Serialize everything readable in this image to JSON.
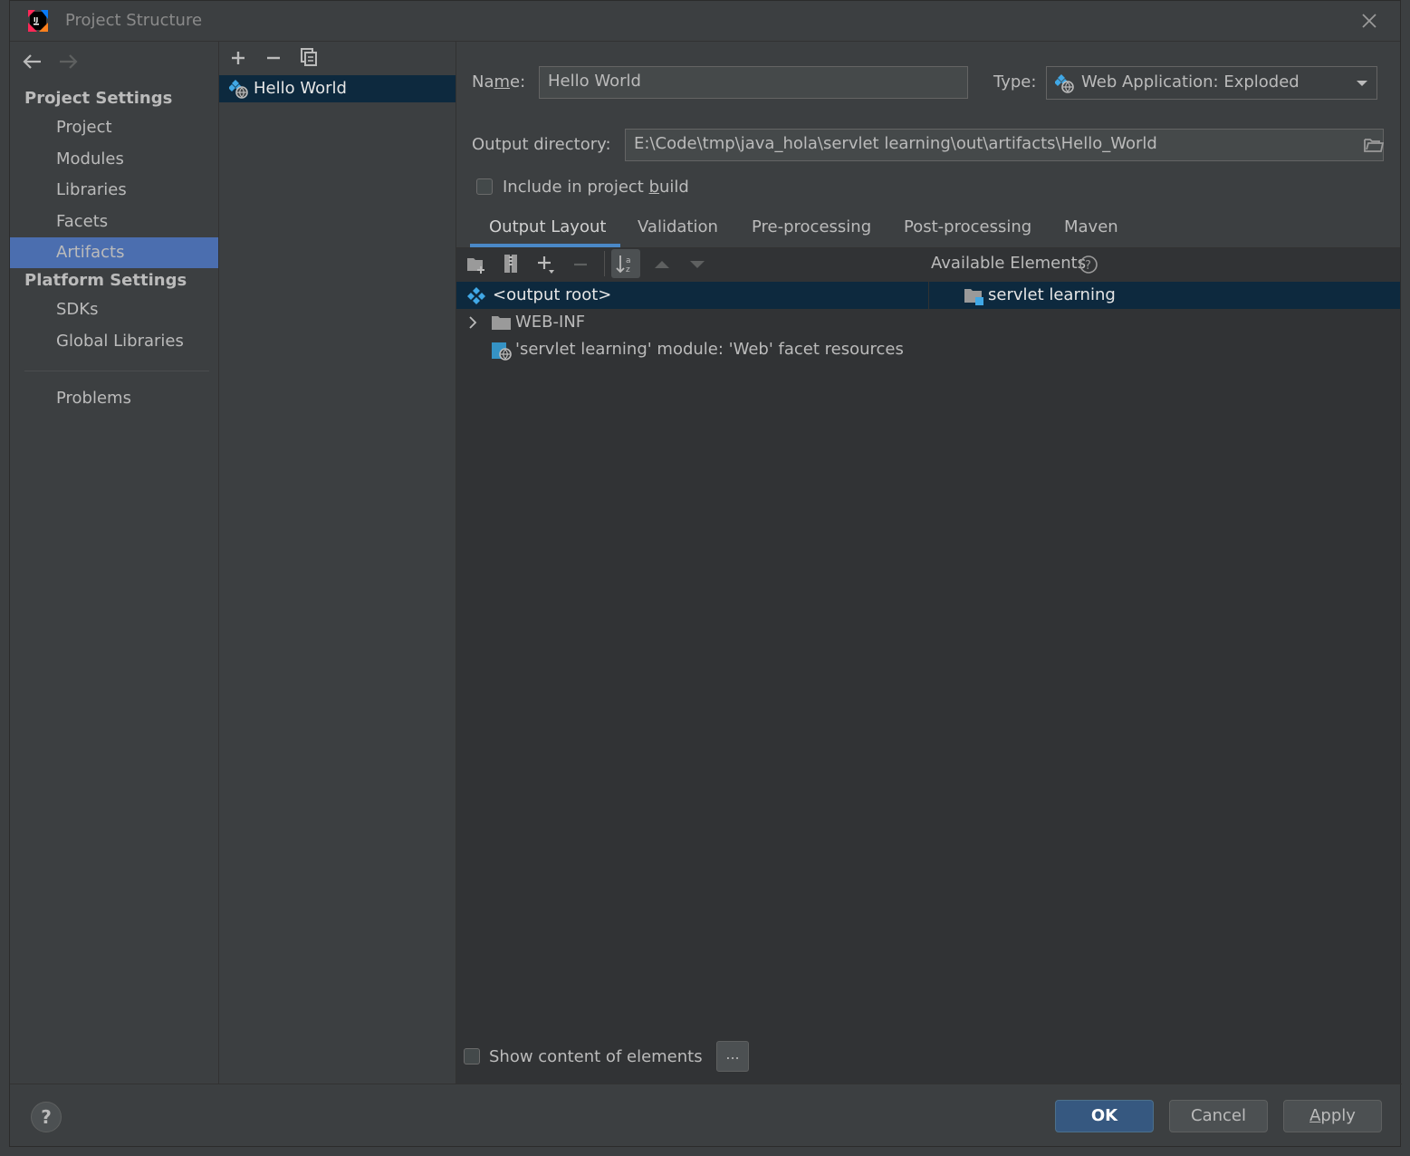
{
  "window": {
    "title": "Project Structure"
  },
  "sidebar": {
    "project_settings_header": "Project Settings",
    "project_items": [
      "Project",
      "Modules",
      "Libraries",
      "Facets",
      "Artifacts"
    ],
    "selected_item": "Artifacts",
    "platform_settings_header": "Platform Settings",
    "platform_items": [
      "SDKs",
      "Global Libraries"
    ],
    "problems_label": "Problems"
  },
  "artifacts_list": {
    "items": [
      "Hello World"
    ]
  },
  "artifact": {
    "name_label_pre": "Na",
    "name_label_mnemonic": "m",
    "name_label_post": "e:",
    "name_value": "Hello World",
    "type_label": "Type:",
    "type_value": "Web Application: Exploded",
    "output_dir_label": "Output directory:",
    "output_dir_value": "E:\\Code\\tmp\\java_hola\\servlet learning\\out\\artifacts\\Hello_World",
    "include_build_label_pre": "Include in project ",
    "include_build_label_mnemonic": "b",
    "include_build_label_post": "uild",
    "include_build_checked": false
  },
  "tabs": [
    "Output Layout",
    "Validation",
    "Pre-processing",
    "Post-processing",
    "Maven"
  ],
  "active_tab": "Output Layout",
  "output_layout": {
    "available_elements_label": "Available Elements",
    "tree": [
      "<output root>",
      "WEB-INF",
      "'servlet learning' module: 'Web' facet resources"
    ],
    "available": [
      "servlet learning"
    ],
    "show_content_label": "Show content of elements",
    "show_content_checked": false,
    "ellipsis_button": "..."
  },
  "footer": {
    "help": "?",
    "ok": "OK",
    "cancel": "Cancel",
    "apply_mnemonic": "A",
    "apply_rest": "pply"
  },
  "colors": {
    "background": "#3c3f41",
    "selection": "#4b6eaf",
    "tree_selection": "#0d293e",
    "ok_button": "#365880",
    "accent": "#4a88c7"
  }
}
